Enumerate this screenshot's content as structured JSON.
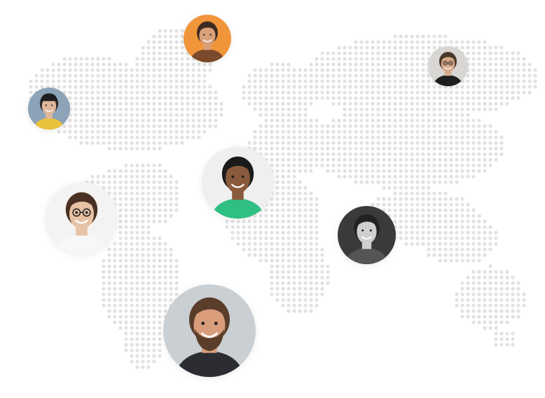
{
  "colors": {
    "map_dot": "#e2e2e2",
    "background": "#ffffff"
  },
  "avatars": [
    {
      "name": "avatar-top-center",
      "bg": "#f0953a",
      "skin": "#d9a07a",
      "hair": "#3b2a22",
      "shirt": "#7a4a2a",
      "accessory": "none"
    },
    {
      "name": "avatar-top-right",
      "bg": "#d8d6d2",
      "skin": "#d8a98a",
      "hair": "#4a3a2a",
      "shirt": "#1e1e1e",
      "accessory": "glasses"
    },
    {
      "name": "avatar-left-top",
      "bg": "#8da3b7",
      "skin": "#e0b79a",
      "hair": "#2a2a2a",
      "shirt": "#e8c23a",
      "accessory": "cap"
    },
    {
      "name": "avatar-center",
      "bg": "#efefef",
      "skin": "#8a5a3c",
      "hair": "#1a1a1a",
      "shirt": "#2fbf83",
      "accessory": "none"
    },
    {
      "name": "avatar-left-middle",
      "bg": "#f4f3f1",
      "skin": "#e7c2a4",
      "hair": "#4a3022",
      "shirt": "#f7f7f7",
      "accessory": "glasses"
    },
    {
      "name": "avatar-right-middle",
      "bg": "#3a3a3a",
      "skin": "#cfcfcf",
      "hair": "#222222",
      "shirt": "#555555",
      "accessory": "none"
    },
    {
      "name": "avatar-bottom",
      "bg": "#c9cfd2",
      "skin": "#d99d7c",
      "hair": "#5a3d2a",
      "shirt": "#2b2d33",
      "accessory": "beard"
    }
  ]
}
